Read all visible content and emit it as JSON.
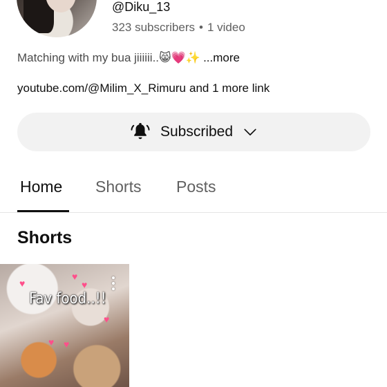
{
  "channel": {
    "handle": "@Diku_13",
    "subscribers": "323 subscribers",
    "separator": "•",
    "videos": "1 video",
    "description": "Matching with my bua jiiiiii..😸💗✨",
    "more_label": "...more",
    "link_text": "youtube.com/@Milim_X_Rimuru",
    "more_links": "and 1 more link"
  },
  "subscribe_button": {
    "label": "Subscribed",
    "icon": "bell-ringing-icon",
    "dropdown_icon": "chevron-down-icon"
  },
  "tabs": [
    {
      "label": "Home",
      "active": true
    },
    {
      "label": "Shorts",
      "active": false
    },
    {
      "label": "Posts",
      "active": false
    }
  ],
  "shorts_section": {
    "title": "Shorts",
    "items": [
      {
        "overlay_text": "Fav food..!!"
      }
    ]
  }
}
